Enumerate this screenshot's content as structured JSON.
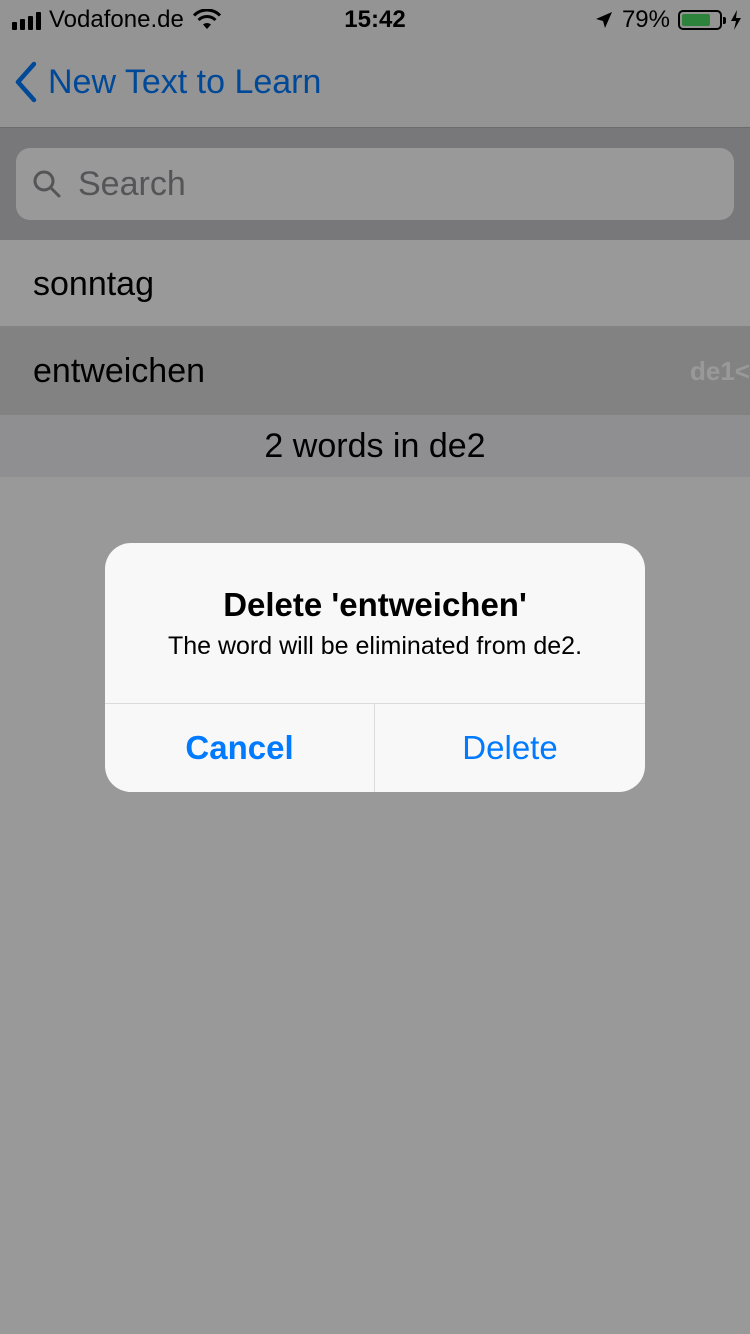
{
  "status_bar": {
    "carrier": "Vodafone.de",
    "time": "15:42",
    "battery_percent": "79%",
    "battery_level": 0.79,
    "icons": [
      "signal-icon",
      "wifi-icon",
      "location-arrow-icon",
      "battery-icon",
      "charging-bolt-icon"
    ]
  },
  "nav": {
    "back_label": "New Text to Learn"
  },
  "search": {
    "placeholder": "Search"
  },
  "words": [
    {
      "text": "sonntag",
      "detail": ""
    },
    {
      "text": "entweichen",
      "detail": "de1<"
    }
  ],
  "footer": {
    "count_text": "2 words in de2"
  },
  "alert": {
    "title": "Delete 'entweichen'",
    "message": "The word will be eliminated from de2.",
    "cancel_label": "Cancel",
    "delete_label": "Delete"
  },
  "colors": {
    "accent": "#007aff",
    "battery": "#4cd964"
  }
}
